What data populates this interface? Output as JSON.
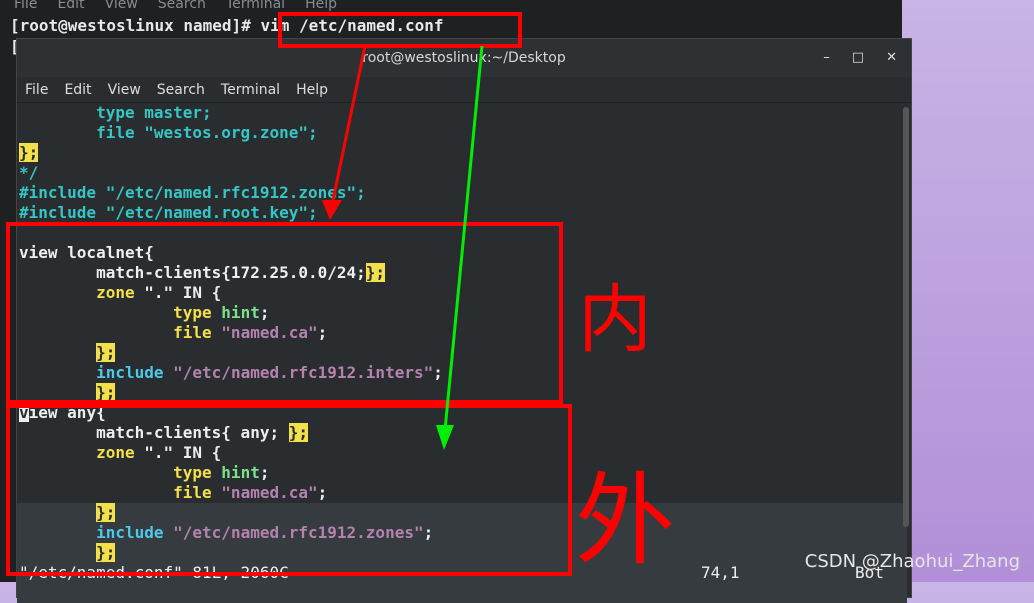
{
  "back_terminal": {
    "menu": [
      "File",
      "Edit",
      "View",
      "Search",
      "Terminal",
      "Help"
    ],
    "prompt": "[root@westoslinux named]# vim /etc/named.conf",
    "prompt2": "["
  },
  "window": {
    "title": "root@westoslinux:~/Desktop",
    "buttons": [
      "–",
      "□",
      "✕"
    ],
    "menu": [
      "File",
      "Edit",
      "View",
      "Search",
      "Terminal",
      "Help"
    ]
  },
  "code": [
    [
      {
        "t": "        "
      },
      {
        "t": "type master;",
        "c": "cm"
      }
    ],
    [
      {
        "t": "        "
      },
      {
        "t": "file \"westos.org.zone\";",
        "c": "cm"
      }
    ],
    [
      {
        "t": "};",
        "c": "br"
      }
    ],
    [
      {
        "t": "*/",
        "c": "cm"
      }
    ],
    [
      {
        "t": "#include \"/etc/named.rfc1912.zones\";",
        "c": "cm"
      }
    ],
    [
      {
        "t": "#include \"/etc/named.root.key\";",
        "c": "cm"
      }
    ],
    [
      {
        "t": ""
      }
    ],
    [
      {
        "t": "view localnet{"
      }
    ],
    [
      {
        "t": "        match-clients{172.25.0.0/24;"
      },
      {
        "t": "};",
        "c": "br"
      }
    ],
    [
      {
        "t": "        "
      },
      {
        "t": "zone",
        "c": "kw"
      },
      {
        "t": " \".\" IN {"
      }
    ],
    [
      {
        "t": "                "
      },
      {
        "t": "type",
        "c": "kw"
      },
      {
        "t": " "
      },
      {
        "t": "hint",
        "c": "grn"
      },
      {
        "t": ";"
      }
    ],
    [
      {
        "t": "                "
      },
      {
        "t": "file",
        "c": "kw"
      },
      {
        "t": " "
      },
      {
        "t": "\"named.ca\"",
        "c": "str"
      },
      {
        "t": ";"
      }
    ],
    [
      {
        "t": "        "
      },
      {
        "t": "};",
        "c": "br"
      }
    ],
    [
      {
        "t": "        "
      },
      {
        "t": "include",
        "c": "inc"
      },
      {
        "t": " "
      },
      {
        "t": "\"/etc/named.rfc1912.inters\"",
        "c": "str"
      },
      {
        "t": ";"
      }
    ],
    [
      {
        "t": "        "
      },
      {
        "t": "};",
        "c": "br"
      }
    ],
    [
      {
        "t": "v",
        "c": "cur"
      },
      {
        "t": "iew any{"
      }
    ],
    [
      {
        "t": "        match-clients{ any; "
      },
      {
        "t": "};",
        "c": "br"
      }
    ],
    [
      {
        "t": "        "
      },
      {
        "t": "zone",
        "c": "kw"
      },
      {
        "t": " \".\" IN {"
      }
    ],
    [
      {
        "t": "                "
      },
      {
        "t": "type",
        "c": "kw"
      },
      {
        "t": " "
      },
      {
        "t": "hint",
        "c": "grn"
      },
      {
        "t": ";"
      }
    ],
    [
      {
        "t": "                "
      },
      {
        "t": "file",
        "c": "kw"
      },
      {
        "t": " "
      },
      {
        "t": "\"named.ca\"",
        "c": "str"
      },
      {
        "t": ";"
      }
    ],
    [
      {
        "t": "        "
      },
      {
        "t": "};",
        "c": "br"
      }
    ],
    [
      {
        "t": "        "
      },
      {
        "t": "include",
        "c": "inc"
      },
      {
        "t": " "
      },
      {
        "t": "\"/etc/named.rfc1912.zones\"",
        "c": "str"
      },
      {
        "t": ";"
      }
    ],
    [
      {
        "t": "        "
      },
      {
        "t": "};",
        "c": "br"
      }
    ]
  ],
  "status": {
    "file": "\"/etc/named.conf\" 81L, 2060C",
    "position": "74,1",
    "scroll": "Bot"
  },
  "annotations": {
    "inner": "内",
    "outer": "外",
    "color": "#ff0000",
    "arrow2_color": "#00ee00"
  },
  "watermark": "CSDN @Zhaohui_Zhang"
}
